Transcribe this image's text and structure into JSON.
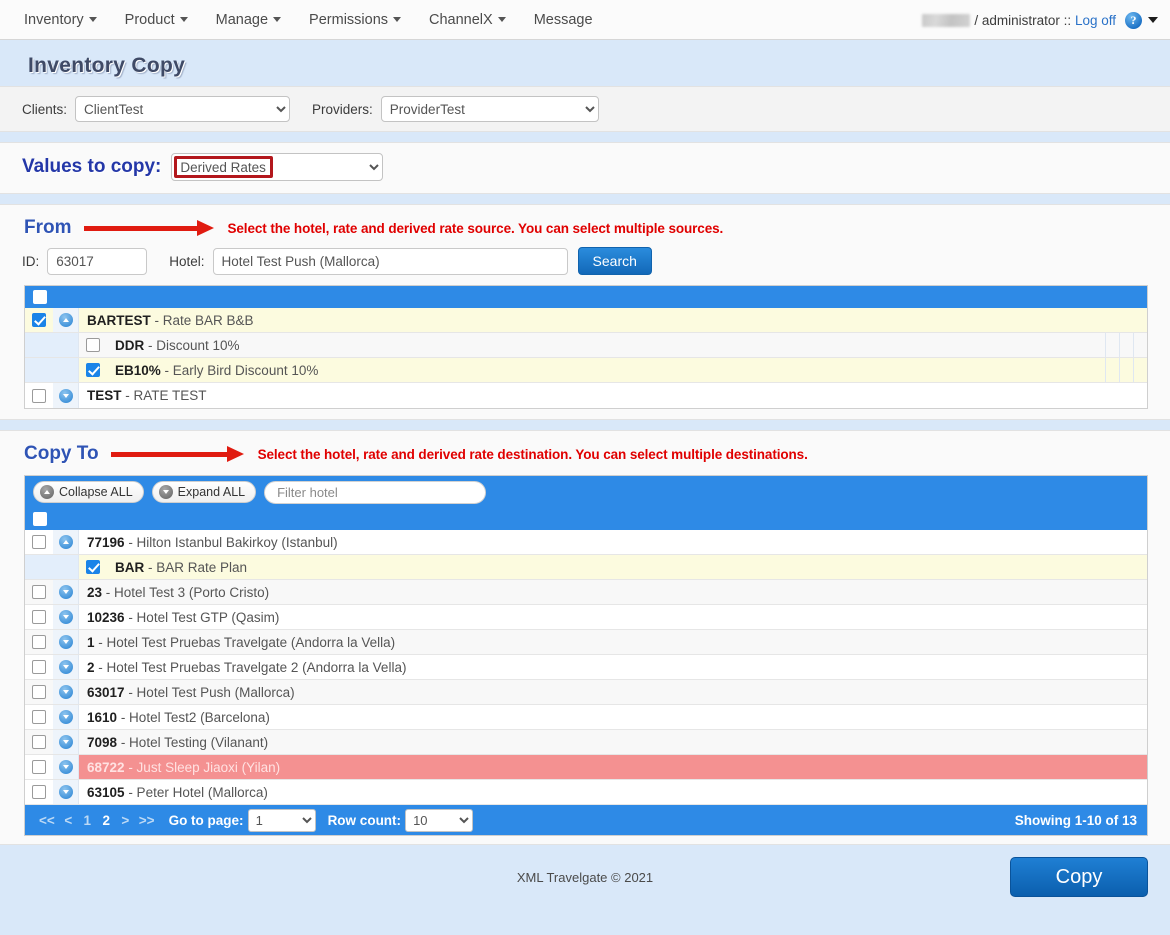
{
  "nav": {
    "items": [
      {
        "label": "Inventory",
        "caret": true
      },
      {
        "label": "Product",
        "caret": true
      },
      {
        "label": "Manage",
        "caret": true
      },
      {
        "label": "Permissions",
        "caret": true
      },
      {
        "label": "ChannelX",
        "caret": true
      },
      {
        "label": "Message",
        "caret": false
      }
    ],
    "user_separator": "/",
    "user_role": "administrator",
    "logoff_separator": "::",
    "logoff_label": "Log off",
    "help_icon": "question-circle-icon"
  },
  "page": {
    "title": "Inventory Copy"
  },
  "filters": {
    "clients_label": "Clients:",
    "clients_value": "ClientTest",
    "providers_label": "Providers:",
    "providers_value": "ProviderTest"
  },
  "values_to_copy": {
    "label": "Values to copy:",
    "value": "Derived Rates",
    "highlight_color": "#b3171c"
  },
  "from": {
    "title": "From",
    "hint": "Select the hotel, rate and derived rate source. You can select multiple sources.",
    "id_label": "ID:",
    "id_value": "63017",
    "hotel_label": "Hotel:",
    "hotel_value": "Hotel Test Push (Mallorca)",
    "search_label": "Search",
    "rows": [
      {
        "type": "parent",
        "checked": true,
        "expanded": true,
        "code": "BARTEST",
        "name": "- Rate BAR B&B",
        "style": "hl"
      },
      {
        "type": "child",
        "checked": false,
        "code": "DDR",
        "name": "- Discount 10%",
        "style": "alt"
      },
      {
        "type": "child",
        "checked": true,
        "code": "EB10%",
        "name": "- Early Bird Discount 10%",
        "style": "hl"
      },
      {
        "type": "parent",
        "checked": false,
        "expanded": false,
        "code": "TEST",
        "name": "- RATE TEST",
        "style": "plain"
      }
    ]
  },
  "copy_to": {
    "title": "Copy To",
    "hint": "Select the hotel, rate and derived rate destination. You can select multiple destinations.",
    "collapse_label": "Collapse ALL",
    "expand_label": "Expand ALL",
    "filter_placeholder": "Filter hotel",
    "rows": [
      {
        "type": "parent",
        "checked": false,
        "expanded": true,
        "code": "77196",
        "name": "- Hilton Istanbul Bakirkoy (Istanbul)",
        "style": "plain"
      },
      {
        "type": "child",
        "checked": true,
        "code": "BAR",
        "name": "- BAR Rate Plan",
        "style": "hl"
      },
      {
        "type": "parent",
        "checked": false,
        "expanded": false,
        "code": "23",
        "name": "- Hotel Test 3 (Porto Cristo)",
        "style": "alt"
      },
      {
        "type": "parent",
        "checked": false,
        "expanded": false,
        "code": "10236",
        "name": "- Hotel Test GTP (Qasim)",
        "style": "plain"
      },
      {
        "type": "parent",
        "checked": false,
        "expanded": false,
        "code": "1",
        "name": "- Hotel Test Pruebas Travelgate (Andorra la Vella)",
        "style": "alt"
      },
      {
        "type": "parent",
        "checked": false,
        "expanded": false,
        "code": "2",
        "name": "- Hotel Test Pruebas Travelgate 2 (Andorra la Vella)",
        "style": "plain"
      },
      {
        "type": "parent",
        "checked": false,
        "expanded": false,
        "code": "63017",
        "name": "- Hotel Test Push (Mallorca)",
        "style": "alt"
      },
      {
        "type": "parent",
        "checked": false,
        "expanded": false,
        "code": "1610",
        "name": "- Hotel Test2 (Barcelona)",
        "style": "plain"
      },
      {
        "type": "parent",
        "checked": false,
        "expanded": false,
        "code": "7098",
        "name": "- Hotel Testing (Vilanant)",
        "style": "alt"
      },
      {
        "type": "parent",
        "checked": false,
        "expanded": false,
        "code": "68722",
        "name": "- Just Sleep Jiaoxi (Yilan)",
        "style": "red"
      },
      {
        "type": "parent",
        "checked": false,
        "expanded": false,
        "code": "63105",
        "name": "- Peter Hotel (Mallorca)",
        "style": "plain"
      }
    ],
    "pager": {
      "first": "<<",
      "prev": "<",
      "page1": "1",
      "page2": "2",
      "next": ">",
      "last": ">>",
      "goto_label": "Go to page:",
      "goto_value": "1",
      "rowcount_label": "Row count:",
      "rowcount_value": "10",
      "showing": "Showing 1-10 of 13"
    }
  },
  "footer": {
    "copyright": "XML Travelgate © 2021",
    "copy_button": "Copy"
  }
}
